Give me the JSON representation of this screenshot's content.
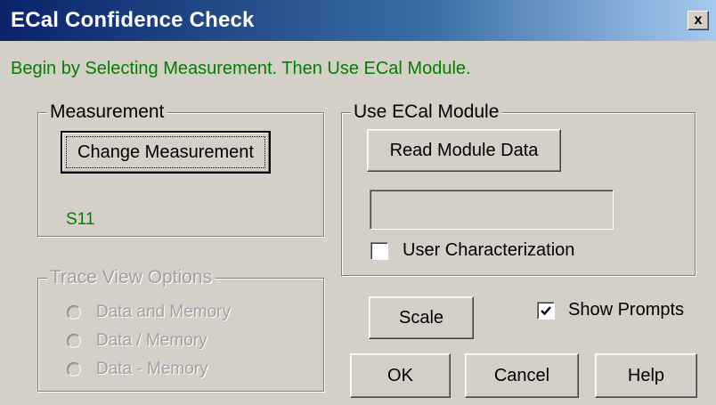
{
  "window": {
    "title": "ECal Confidence Check",
    "close_label": "x"
  },
  "prompt": "Begin by Selecting Measurement.  Then Use ECal Module.",
  "measurement": {
    "legend": "Measurement",
    "change_button": "Change Measurement",
    "current": "S11"
  },
  "ecal_module": {
    "legend": "Use ECal Module",
    "read_button": "Read Module Data",
    "module_info_value": "",
    "user_characterization": {
      "label": "User Characterization",
      "checked": false
    }
  },
  "trace_view": {
    "legend": "Trace View Options",
    "enabled": false,
    "options": [
      {
        "label": "Data and Memory",
        "selected": false
      },
      {
        "label": "Data / Memory",
        "selected": false
      },
      {
        "label": "Data - Memory",
        "selected": false
      }
    ]
  },
  "scale_button": "Scale",
  "show_prompts": {
    "label": "Show Prompts",
    "checked": true
  },
  "buttons": {
    "ok": "OK",
    "cancel": "Cancel",
    "help": "Help"
  },
  "colors": {
    "prompt": "#008000",
    "titlebar": "#0a246a",
    "disabled_text": "#a0a0a0"
  }
}
